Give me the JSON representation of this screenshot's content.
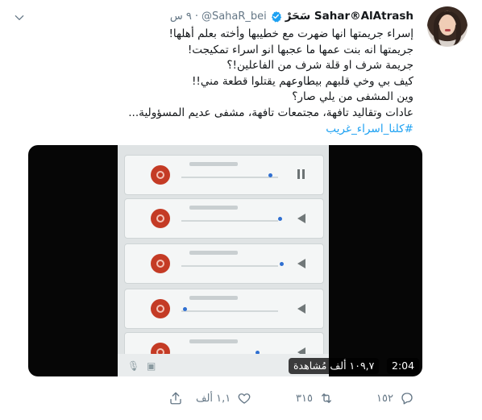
{
  "author": {
    "name": "سَحَرْ Sahar®AlAtrash",
    "handle": "@SahaR_bei",
    "separator": "·",
    "time": "٩ س"
  },
  "tweet": {
    "lines": [
      "إسراء جريمتها انها ضهرت مع خطيبها وأخته بعلم أهلها!",
      "جريمتها انه بنت عمها ما عجبها انو اسراء تمكيجت!",
      "جريمة شرف او قلة شرف من الفاعلين!؟",
      "كيف بي وخي قلبهم بيطاوعهم يقتلوا قطعة مني!!",
      "وين المشفى من يلي صار؟",
      "عادات وتقاليد تافهة، مجتمعات تافهة، مشفى عديم المسؤولية..."
    ],
    "hashtag": "#كلنا_اسراء_غريب"
  },
  "video": {
    "duration": "2:04",
    "views": "١٠٩,٧ ألف مُشاهدة",
    "play_progress_fraction": 0.0
  },
  "actions": {
    "reply": "١٥٢",
    "retweet": "٣١٥",
    "like": "١,١ ألف"
  },
  "colors": {
    "accent": "#1da1f2",
    "muted": "#657786",
    "text": "#14171a"
  }
}
